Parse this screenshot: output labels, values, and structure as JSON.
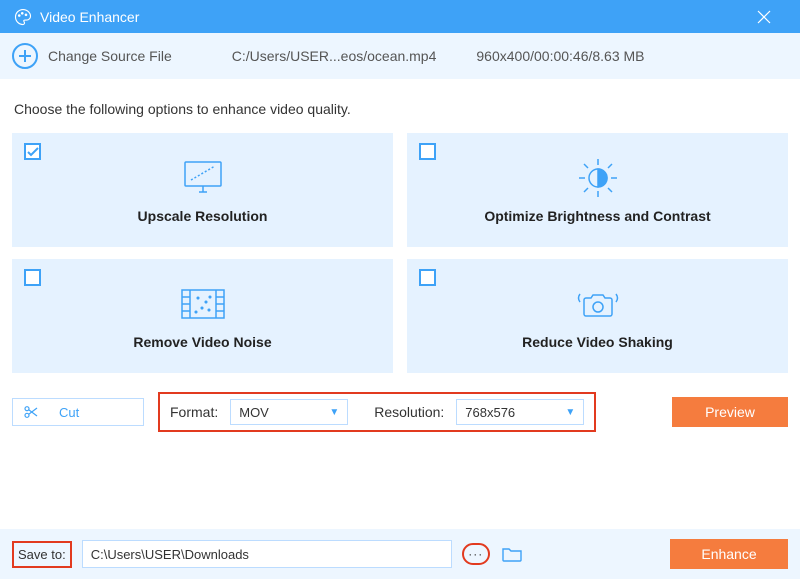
{
  "titlebar": {
    "title": "Video Enhancer"
  },
  "source": {
    "change_label": "Change Source File",
    "path": "C:/Users/USER...eos/ocean.mp4",
    "info": "960x400/00:00:46/8.63 MB"
  },
  "instruction": "Choose the following options to enhance video quality.",
  "options": [
    {
      "label": "Upscale Resolution",
      "checked": true
    },
    {
      "label": "Optimize Brightness and Contrast",
      "checked": false
    },
    {
      "label": "Remove Video Noise",
      "checked": false
    },
    {
      "label": "Reduce Video Shaking",
      "checked": false
    }
  ],
  "controls": {
    "cut_label": "Cut",
    "format_label": "Format:",
    "format_value": "MOV",
    "resolution_label": "Resolution:",
    "resolution_value": "768x576",
    "preview_label": "Preview"
  },
  "footer": {
    "save_to_label": "Save to:",
    "save_path": "C:\\Users\\USER\\Downloads",
    "browse_label": "···",
    "enhance_label": "Enhance"
  }
}
